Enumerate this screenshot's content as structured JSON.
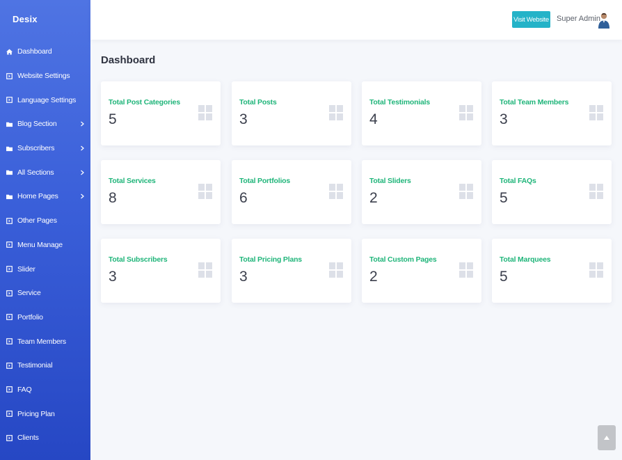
{
  "sidebar": {
    "brand": "Desix",
    "items": [
      {
        "label": "Dashboard",
        "icon": "home-icon",
        "chevron": false
      },
      {
        "label": "Website Settings",
        "icon": "square-arrow-icon",
        "chevron": false
      },
      {
        "label": "Language Settings",
        "icon": "square-arrow-icon",
        "chevron": false
      },
      {
        "label": "Blog Section",
        "icon": "folder-icon",
        "chevron": true
      },
      {
        "label": "Subscribers",
        "icon": "folder-icon",
        "chevron": true
      },
      {
        "label": "All Sections",
        "icon": "folder-icon",
        "chevron": true
      },
      {
        "label": "Home Pages",
        "icon": "folder-icon",
        "chevron": true
      },
      {
        "label": "Other Pages",
        "icon": "square-arrow-icon",
        "chevron": false
      },
      {
        "label": "Menu Manage",
        "icon": "square-arrow-icon",
        "chevron": false
      },
      {
        "label": "Slider",
        "icon": "square-arrow-icon",
        "chevron": false
      },
      {
        "label": "Service",
        "icon": "square-arrow-icon",
        "chevron": false
      },
      {
        "label": "Portfolio",
        "icon": "square-arrow-icon",
        "chevron": false
      },
      {
        "label": "Team Members",
        "icon": "square-arrow-icon",
        "chevron": false
      },
      {
        "label": "Testimonial",
        "icon": "square-arrow-icon",
        "chevron": false
      },
      {
        "label": "FAQ",
        "icon": "square-arrow-icon",
        "chevron": false
      },
      {
        "label": "Pricing Plan",
        "icon": "square-arrow-icon",
        "chevron": false
      },
      {
        "label": "Clients",
        "icon": "square-arrow-icon",
        "chevron": false
      }
    ]
  },
  "header": {
    "visit_label": "Visit Website",
    "user_name": "Super Admin"
  },
  "page": {
    "title": "Dashboard"
  },
  "cards": [
    {
      "label": "Total Post Categories",
      "value": "5"
    },
    {
      "label": "Total Posts",
      "value": "3"
    },
    {
      "label": "Total Testimonials",
      "value": "4"
    },
    {
      "label": "Total Team Members",
      "value": "3"
    },
    {
      "label": "Total Services",
      "value": "8"
    },
    {
      "label": "Total Portfolios",
      "value": "6"
    },
    {
      "label": "Total Sliders",
      "value": "2"
    },
    {
      "label": "Total FAQs",
      "value": "5"
    },
    {
      "label": "Total Subscribers",
      "value": "3"
    },
    {
      "label": "Total Pricing Plans",
      "value": "3"
    },
    {
      "label": "Total Custom Pages",
      "value": "2"
    },
    {
      "label": "Total Marquees",
      "value": "5"
    }
  ],
  "colors": {
    "sidebar_top": "#4f74e3",
    "sidebar_bottom": "#2647c4",
    "accent_button": "#24b3c8",
    "card_label": "#20b57a",
    "card_icon": "#dde0e8"
  }
}
